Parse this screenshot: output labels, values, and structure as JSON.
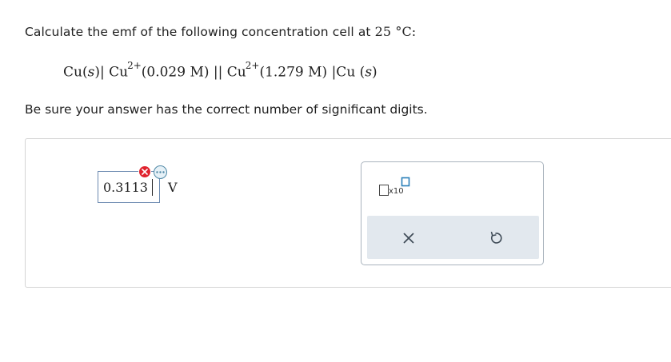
{
  "question": {
    "prompt_text": "Calculate the emf of the following concentration cell at",
    "temperature": "25 °C:",
    "equation": {
      "left_electrode": "Cu(",
      "left_state": "s",
      "left_close": ")| Cu",
      "charge1": "2+",
      "concentration1": "(0.029 M) || Cu",
      "charge2": "2+",
      "concentration2": "(1.279 M) |Cu (",
      "right_state": "s",
      "right_close": ")"
    },
    "instruction": "Be sure your answer has the correct number of significant digits."
  },
  "answer": {
    "value": "0.3113",
    "unit": "V",
    "status": "incorrect"
  },
  "toolbox": {
    "sci_notation_label": "x10"
  },
  "colors": {
    "error": "#e0232e",
    "hint_border": "#4f88a6",
    "tool_row_bg": "#e2e8ee",
    "input_border": "#6c8ab0"
  },
  "icons": {
    "error": "x-circle-icon",
    "hint": "ellipsis-icon",
    "clear": "close-icon",
    "undo": "undo-icon"
  }
}
